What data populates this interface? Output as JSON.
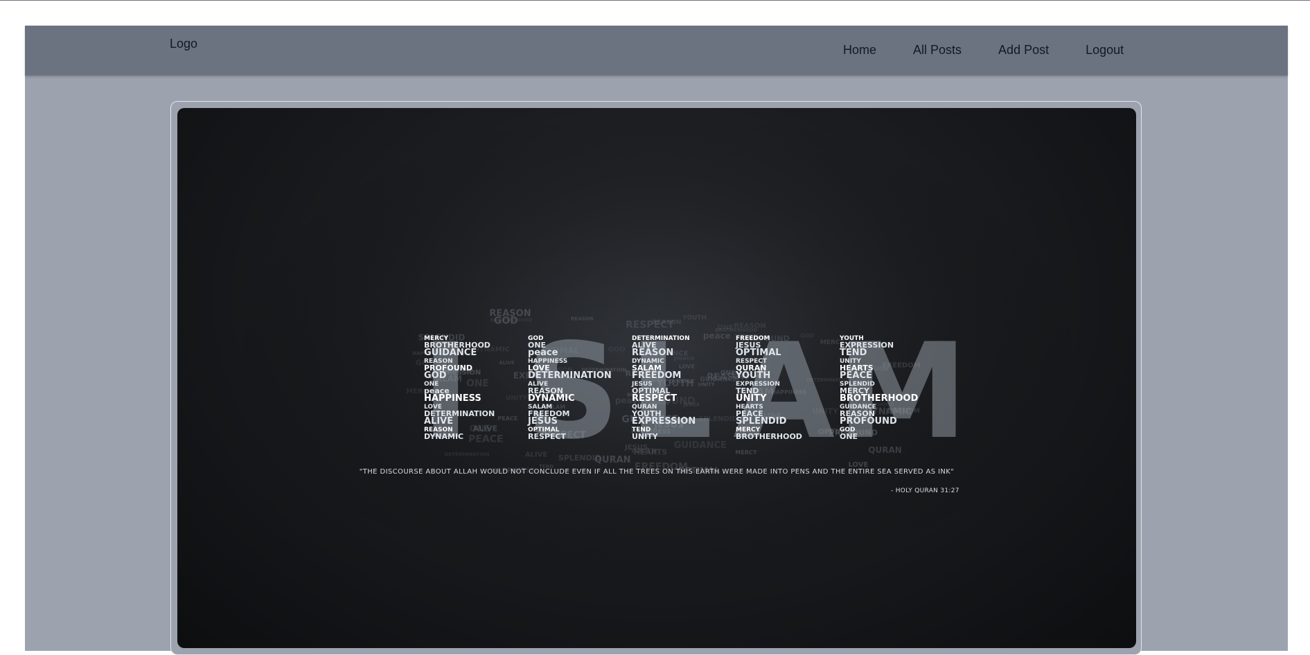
{
  "navbar": {
    "logo": "Logo",
    "links": [
      {
        "label": "Home"
      },
      {
        "label": "All Posts"
      },
      {
        "label": "Add Post"
      },
      {
        "label": "Logout"
      }
    ]
  },
  "hero": {
    "title_word": "ISLAM",
    "quote": "\"THE DISCOURSE ABOUT ALLAH WOULD NOT CONCLUDE EVEN IF ALL THE TREES ON THIS EARTH WERE MADE INTO PENS AND THE ENTIRE SEA SERVED AS INK\"",
    "source": "- HOLY QURAN 31:27",
    "words": [
      "MERCY",
      "BROTHERHOOD",
      "GUIDANCE",
      "REASON",
      "PROFOUND",
      "GOD",
      "ONE",
      "peace",
      "HAPPINESS",
      "LOVE",
      "DETERMINATION",
      "ALIVE",
      "REASON",
      "DYNAMIC",
      "SALAM",
      "FREEDOM",
      "JESUS",
      "OPTIMAL",
      "RESPECT",
      "QURAN",
      "YOUTH",
      "EXPRESSION",
      "TEND",
      "UNITY",
      "HEARTS",
      "PEACE",
      "SPLENDID"
    ]
  },
  "colors": {
    "frame_bg": "#9ca3af",
    "navbar_bg": "#6b7280",
    "hero_dark": "#0d0e10"
  }
}
